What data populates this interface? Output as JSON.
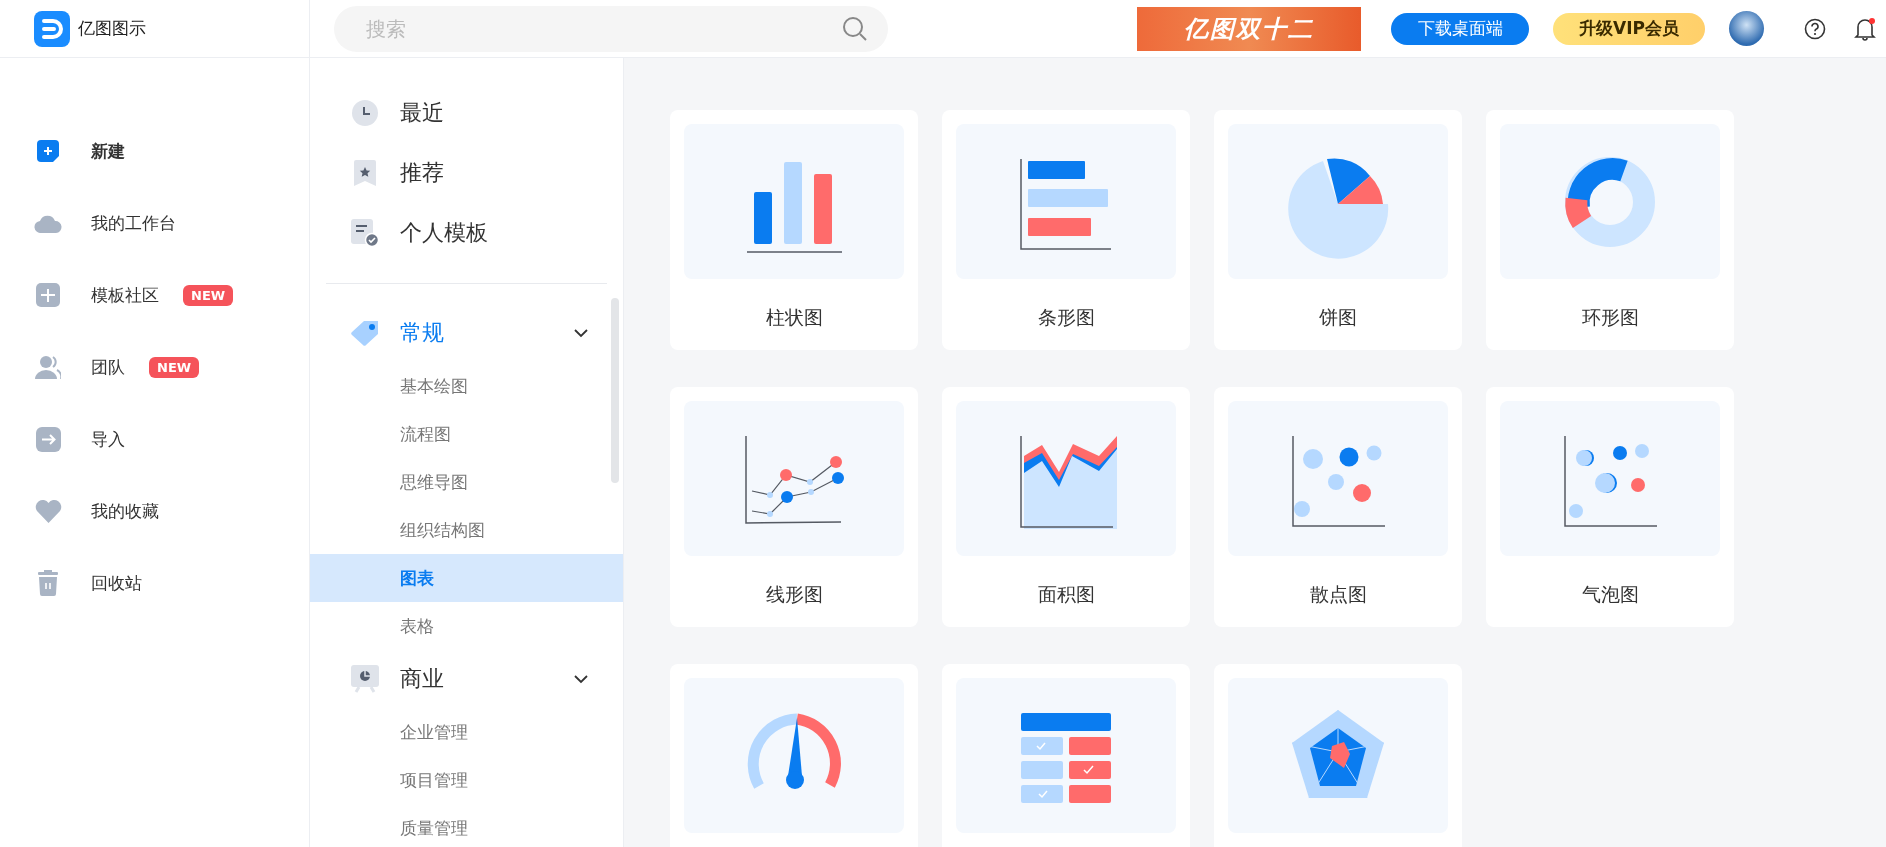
{
  "app": {
    "name": "亿图图示"
  },
  "search": {
    "placeholder": "搜索"
  },
  "header": {
    "banner": "亿图双十二",
    "download_button": "下载桌面端",
    "vip_button": "升级VIP会员"
  },
  "sidebar": {
    "items": [
      {
        "label": "新建",
        "selected": true
      },
      {
        "label": "我的工作台",
        "selected": false
      },
      {
        "label": "模板社区",
        "selected": false,
        "badge": "NEW"
      },
      {
        "label": "团队",
        "selected": false,
        "badge": "NEW"
      },
      {
        "label": "导入",
        "selected": false
      },
      {
        "label": "我的收藏",
        "selected": false
      },
      {
        "label": "回收站",
        "selected": false
      }
    ]
  },
  "categories": {
    "top_items": [
      {
        "label": "最近"
      },
      {
        "label": "推荐"
      },
      {
        "label": "个人模板"
      }
    ],
    "groups": [
      {
        "label": "常规",
        "expanded": true,
        "selected": true,
        "children": [
          {
            "label": "基本绘图",
            "selected": false
          },
          {
            "label": "流程图",
            "selected": false
          },
          {
            "label": "思维导图",
            "selected": false
          },
          {
            "label": "组织结构图",
            "selected": false
          },
          {
            "label": "图表",
            "selected": true
          },
          {
            "label": "表格",
            "selected": false
          }
        ]
      },
      {
        "label": "商业",
        "expanded": true,
        "selected": false,
        "children": [
          {
            "label": "企业管理",
            "selected": false
          },
          {
            "label": "项目管理",
            "selected": false
          },
          {
            "label": "质量管理",
            "selected": false
          }
        ]
      }
    ]
  },
  "templates": [
    {
      "kind": "bar",
      "label": "柱状图"
    },
    {
      "kind": "hbar",
      "label": "条形图"
    },
    {
      "kind": "pie",
      "label": "饼图"
    },
    {
      "kind": "donut",
      "label": "环形图"
    },
    {
      "kind": "line",
      "label": "线形图"
    },
    {
      "kind": "area",
      "label": "面积图"
    },
    {
      "kind": "scatter",
      "label": "散点图"
    },
    {
      "kind": "bubble",
      "label": "气泡图"
    },
    {
      "kind": "gauge"
    },
    {
      "kind": "table"
    },
    {
      "kind": "radar"
    }
  ]
}
